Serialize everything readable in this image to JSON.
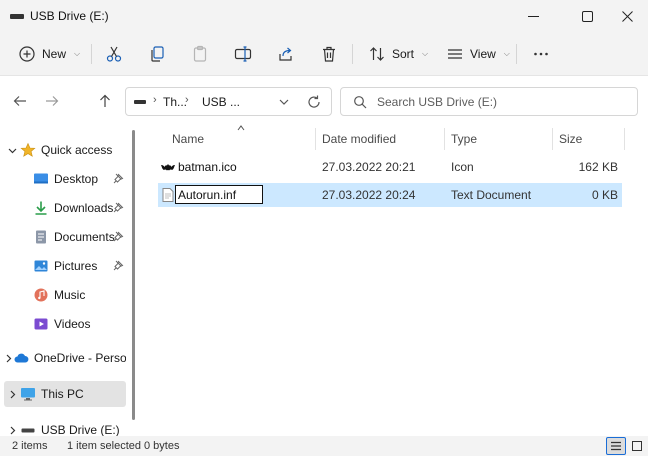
{
  "window": {
    "title": "USB Drive (E:)"
  },
  "toolbar": {
    "new_label": "New",
    "sort_label": "Sort",
    "view_label": "View"
  },
  "address": {
    "crumbs": [
      "Th...",
      "USB ..."
    ]
  },
  "search": {
    "placeholder": "Search USB Drive (E:)"
  },
  "sidebar": {
    "items": [
      {
        "label": "Quick access",
        "icon": "star-icon"
      },
      {
        "label": "Desktop",
        "icon": "desktop-icon",
        "pinned": true
      },
      {
        "label": "Downloads",
        "icon": "download-icon",
        "pinned": true
      },
      {
        "label": "Documents",
        "icon": "documents-icon",
        "pinned": true
      },
      {
        "label": "Pictures",
        "icon": "pictures-icon",
        "pinned": true
      },
      {
        "label": "Music",
        "icon": "music-icon"
      },
      {
        "label": "Videos",
        "icon": "videos-icon"
      },
      {
        "label": "OneDrive - Perso",
        "icon": "cloud-icon"
      },
      {
        "label": "This PC",
        "icon": "monitor-icon"
      },
      {
        "label": "USB Drive (E:)",
        "icon": "usb-drive-icon"
      }
    ]
  },
  "columns": {
    "name": "Name",
    "date": "Date modified",
    "type": "Type",
    "size": "Size"
  },
  "files": [
    {
      "name": "batman.ico",
      "date": "27.03.2022 20:21",
      "type": "Icon",
      "size": "162 KB",
      "icon": "batman-icon"
    },
    {
      "name": "Autorun.inf",
      "date": "27.03.2022 20:24",
      "type": "Text Document",
      "size": "0 KB",
      "icon": "text-file-icon",
      "renaming": true
    }
  ],
  "status": {
    "count": "2 items",
    "selected": "1 item selected",
    "size": "0 bytes"
  }
}
